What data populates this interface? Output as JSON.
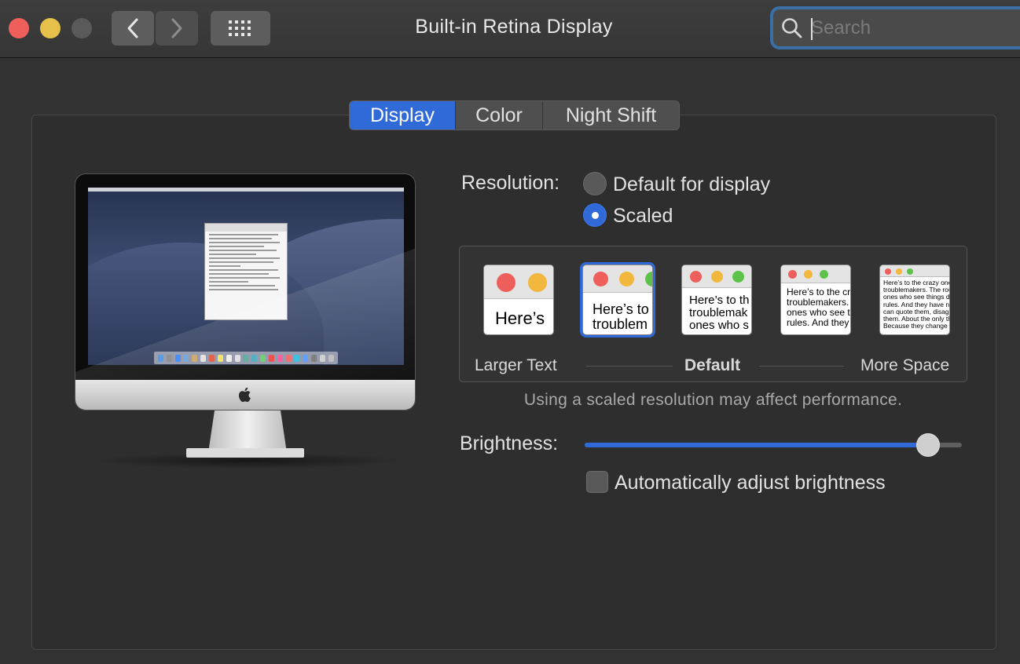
{
  "window": {
    "title": "Built-in Retina Display",
    "search_placeholder": "Search"
  },
  "tabs": [
    {
      "label": "Display",
      "active": true
    },
    {
      "label": "Color",
      "active": false
    },
    {
      "label": "Night Shift",
      "active": false
    }
  ],
  "resolution": {
    "label": "Resolution:",
    "options": [
      {
        "label": "Default for display",
        "selected": false
      },
      {
        "label": "Scaled",
        "selected": true
      }
    ],
    "scale_previews": [
      {
        "text": "Here’s",
        "selected": false
      },
      {
        "text": "Here’s to\ntroublem",
        "selected": true
      },
      {
        "text": "Here’s to th\ntroublemak\nones who s",
        "selected": false
      },
      {
        "text": "Here’s to the cr\ntroublemakers.\nones who see t\nrules. And they",
        "selected": false
      },
      {
        "text": "Here’s to the crazy ones\ntroublemakers. The rou\nones who see things di\nrules. And they have no\ncan quote them, disagre\nthem. About the only th\nBecause they change t",
        "selected": false
      }
    ],
    "caption_left": "Larger Text",
    "caption_center": "Default",
    "caption_right": "More Space",
    "note": "Using a scaled resolution may affect performance."
  },
  "brightness": {
    "label": "Brightness:",
    "value_fraction": 0.91,
    "auto_label": "Automatically adjust brightness",
    "auto_checked": false
  },
  "colors": {
    "accent": "#2f6ad8",
    "close": "#ee5f5b",
    "minimize": "#e5c14b",
    "zoom_disabled": "#5a5a5a"
  }
}
